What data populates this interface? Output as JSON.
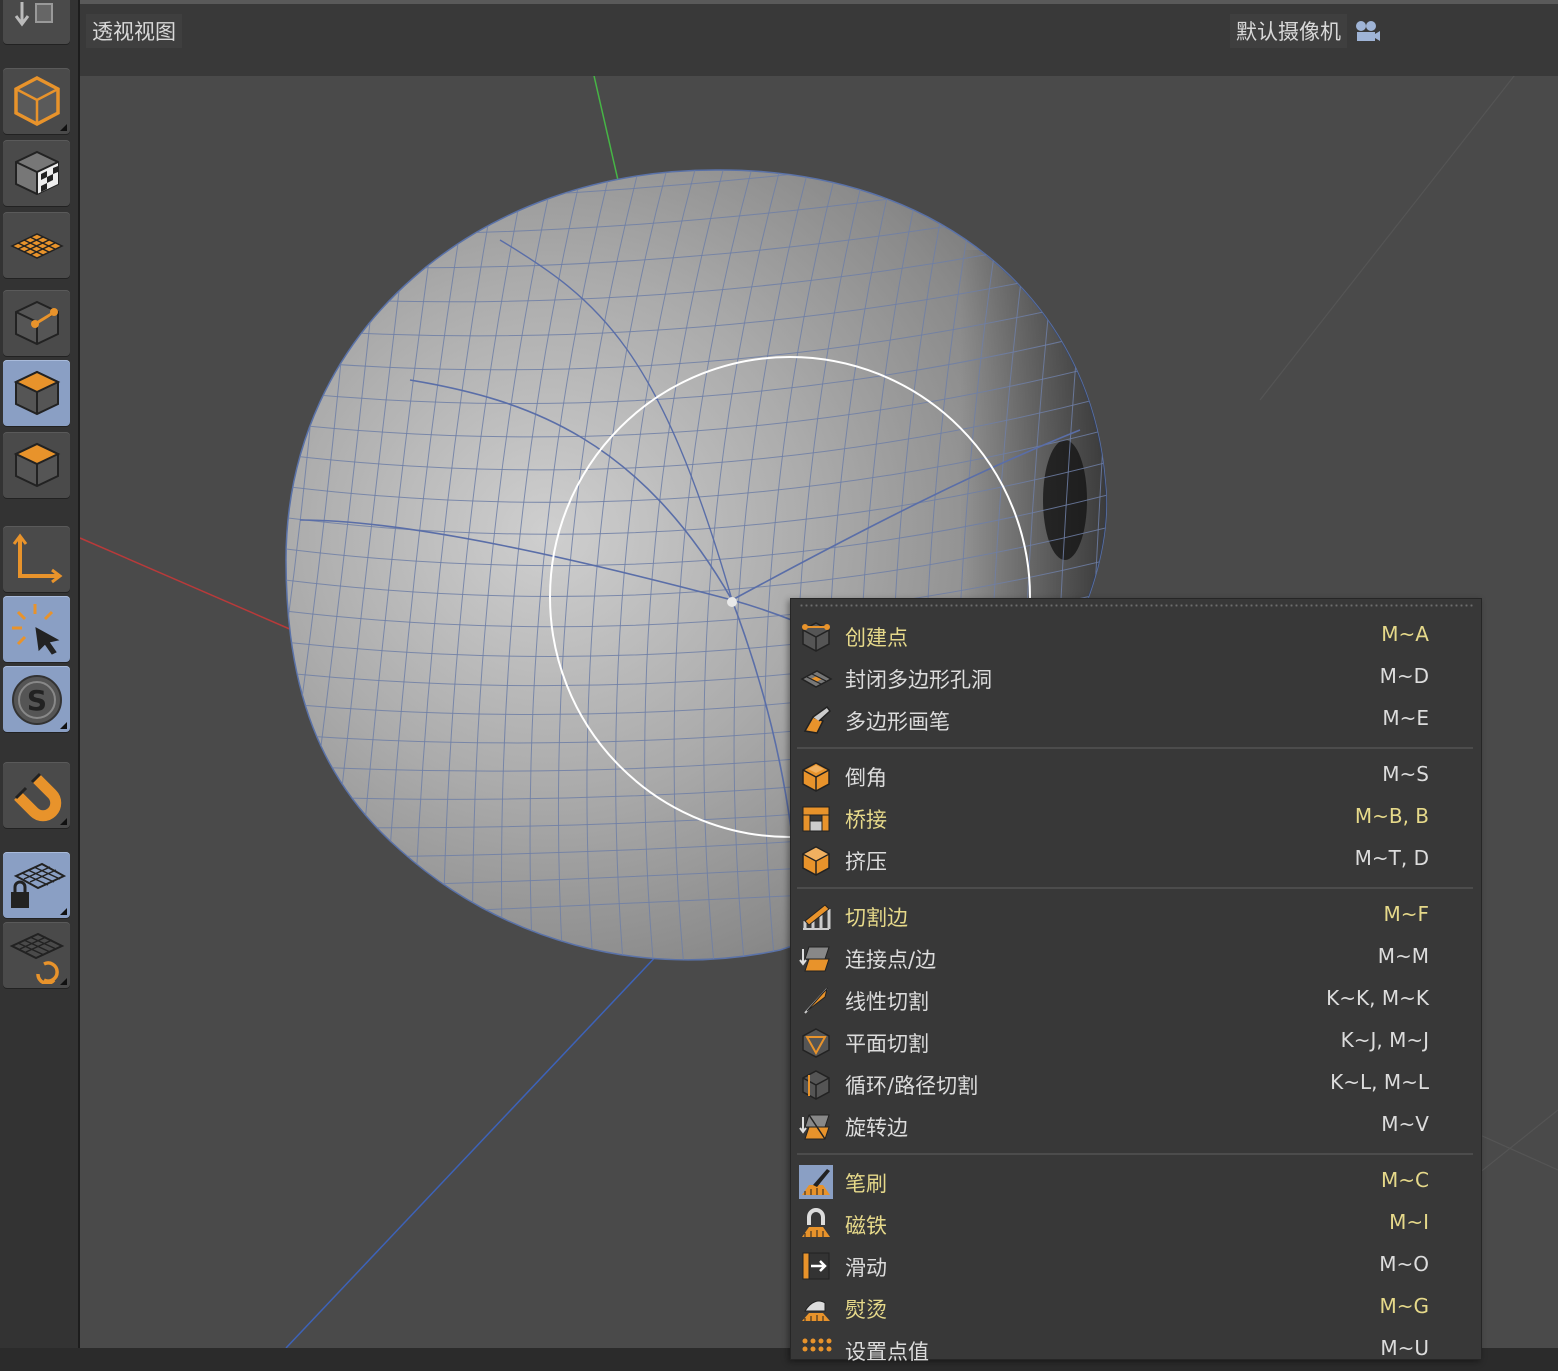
{
  "viewport": {
    "title": "透视视图",
    "camera": "默认摄像机"
  },
  "toolbar": {
    "tools": [
      {
        "name": "cube-object-icon",
        "active": false
      },
      {
        "name": "texture-cube-icon",
        "active": false
      },
      {
        "name": "plane-grid-icon",
        "active": false
      },
      {
        "name": "point-mode-icon",
        "active": false
      },
      {
        "name": "edge-mode-icon",
        "active": true
      },
      {
        "name": "polygon-mode-icon",
        "active": false
      },
      {
        "name": "axis-icon",
        "active": false
      },
      {
        "name": "live-selection-icon",
        "active": true
      },
      {
        "name": "snap-s-icon",
        "active": true
      },
      {
        "name": "magnet-icon",
        "active": false
      },
      {
        "name": "locked-workplane-icon",
        "active": true
      },
      {
        "name": "workplane-sync-icon",
        "active": false
      }
    ]
  },
  "menu": {
    "items": [
      {
        "label": "创建点",
        "shortcut": "M~A",
        "highlight": true,
        "icon": "create-point-icon"
      },
      {
        "label": "封闭多边形孔洞",
        "shortcut": "M~D",
        "highlight": false,
        "icon": "close-polygon-hole-icon"
      },
      {
        "label": "多边形画笔",
        "shortcut": "M~E",
        "highlight": false,
        "icon": "polygon-pen-icon"
      },
      {
        "label": "倒角",
        "shortcut": "M~S",
        "highlight": false,
        "icon": "bevel-icon"
      },
      {
        "label": "桥接",
        "shortcut": "M~B, B",
        "highlight": true,
        "icon": "bridge-icon"
      },
      {
        "label": "挤压",
        "shortcut": "M~T, D",
        "highlight": false,
        "icon": "extrude-icon"
      },
      {
        "label": "切割边",
        "shortcut": "M~F",
        "highlight": true,
        "icon": "edge-cut-icon"
      },
      {
        "label": "连接点/边",
        "shortcut": "M~M",
        "highlight": false,
        "icon": "connect-points-edges-icon"
      },
      {
        "label": "线性切割",
        "shortcut": "K~K, M~K",
        "highlight": false,
        "icon": "line-cut-icon"
      },
      {
        "label": "平面切割",
        "shortcut": "K~J, M~J",
        "highlight": false,
        "icon": "plane-cut-icon"
      },
      {
        "label": "循环/路径切割",
        "shortcut": "K~L, M~L",
        "highlight": false,
        "icon": "loop-path-cut-icon"
      },
      {
        "label": "旋转边",
        "shortcut": "M~V",
        "highlight": false,
        "icon": "spin-edge-icon"
      },
      {
        "label": "笔刷",
        "shortcut": "M~C",
        "highlight": true,
        "icon": "brush-icon",
        "active": true
      },
      {
        "label": "磁铁",
        "shortcut": "M~I",
        "highlight": true,
        "icon": "magnet-tool-icon"
      },
      {
        "label": "滑动",
        "shortcut": "M~O",
        "highlight": false,
        "icon": "slide-icon"
      },
      {
        "label": "熨烫",
        "shortcut": "M~G",
        "highlight": true,
        "icon": "iron-icon"
      },
      {
        "label": "设置点值",
        "shortcut": "M~U",
        "highlight": false,
        "icon": "set-point-value-icon"
      }
    ]
  }
}
